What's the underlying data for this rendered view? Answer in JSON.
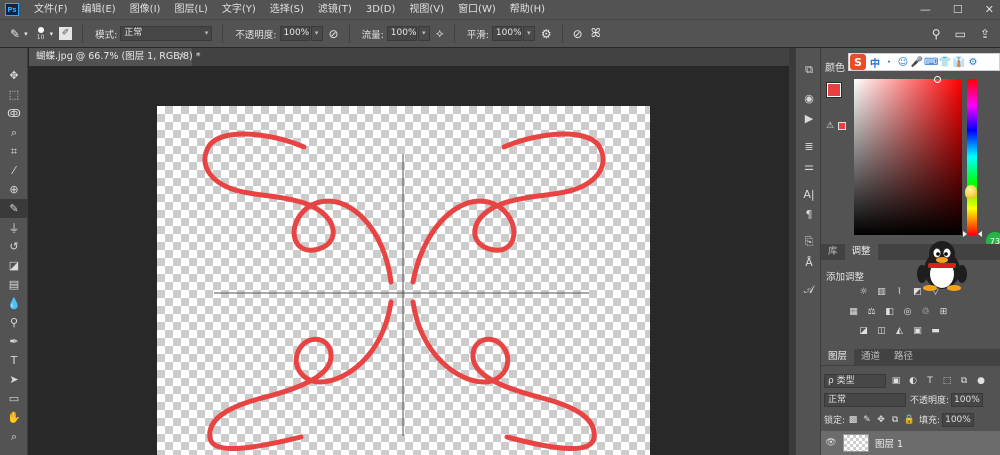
{
  "app": {
    "logo": "Ps"
  },
  "menu": [
    "文件(F)",
    "编辑(E)",
    "图像(I)",
    "图层(L)",
    "文字(Y)",
    "选择(S)",
    "滤镜(T)",
    "3D(D)",
    "视图(V)",
    "窗口(W)",
    "帮助(H)"
  ],
  "window_controls": {
    "minimize": "—",
    "maximize": "☐",
    "close": "✕"
  },
  "options": {
    "brush_size": "10",
    "mode_label": "模式:",
    "mode_value": "正常",
    "opacity_label": "不透明度:",
    "opacity_value": "100%",
    "flow_label": "流量:",
    "flow_value": "100%",
    "smoothing_label": "平滑:",
    "smoothing_value": "100%"
  },
  "document": {
    "tab_title": "蝴蝶.jpg @ 66.7% (图层 1, RGB/8) *",
    "close": "×"
  },
  "color_panel": {
    "tab": "颜色",
    "foreground_color": "#e84040",
    "background_color": "#ffffff"
  },
  "ime": {
    "logo": "S",
    "lang": "中",
    "items": [
      "·",
      "☺",
      "🎤",
      "⌨",
      "👕",
      "👔",
      "⚙"
    ]
  },
  "adjust_panel": {
    "tabs": [
      "库",
      "调整"
    ],
    "add_label": "添加调整"
  },
  "badge": {
    "value": "73"
  },
  "layers_panel": {
    "tabs": [
      "图层",
      "通道",
      "路径"
    ],
    "kind_label": "ρ 类型",
    "blend_mode": "正常",
    "opacity_label": "不透明度:",
    "opacity_value": "100%",
    "lock_label": "锁定:",
    "fill_label": "填充:",
    "fill_value": "100%",
    "layer_name": "图层 1"
  }
}
